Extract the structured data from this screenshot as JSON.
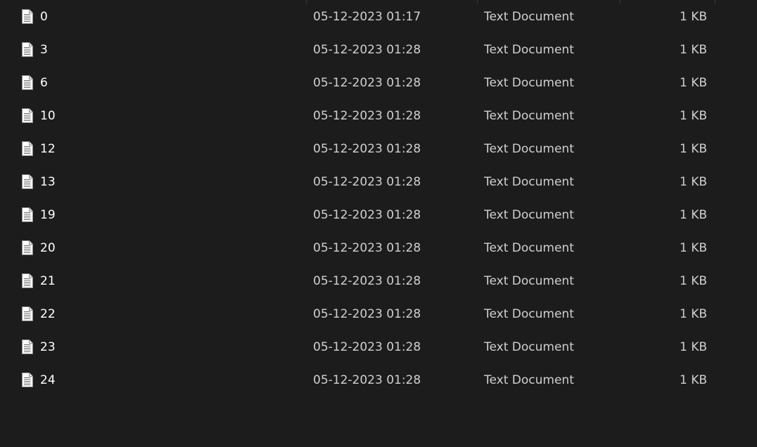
{
  "file_icon": "text-document-icon",
  "colors": {
    "background": "#1c1c1c",
    "name_text": "#ffffff",
    "detail_text": "#d0d0d0",
    "divider": "#3a3a3a"
  },
  "files": [
    {
      "name": "0",
      "date_modified": "05-12-2023 01:17",
      "type": "Text Document",
      "size": "1 KB"
    },
    {
      "name": "3",
      "date_modified": "05-12-2023 01:28",
      "type": "Text Document",
      "size": "1 KB"
    },
    {
      "name": "6",
      "date_modified": "05-12-2023 01:28",
      "type": "Text Document",
      "size": "1 KB"
    },
    {
      "name": "10",
      "date_modified": "05-12-2023 01:28",
      "type": "Text Document",
      "size": "1 KB"
    },
    {
      "name": "12",
      "date_modified": "05-12-2023 01:28",
      "type": "Text Document",
      "size": "1 KB"
    },
    {
      "name": "13",
      "date_modified": "05-12-2023 01:28",
      "type": "Text Document",
      "size": "1 KB"
    },
    {
      "name": "19",
      "date_modified": "05-12-2023 01:28",
      "type": "Text Document",
      "size": "1 KB"
    },
    {
      "name": "20",
      "date_modified": "05-12-2023 01:28",
      "type": "Text Document",
      "size": "1 KB"
    },
    {
      "name": "21",
      "date_modified": "05-12-2023 01:28",
      "type": "Text Document",
      "size": "1 KB"
    },
    {
      "name": "22",
      "date_modified": "05-12-2023 01:28",
      "type": "Text Document",
      "size": "1 KB"
    },
    {
      "name": "23",
      "date_modified": "05-12-2023 01:28",
      "type": "Text Document",
      "size": "1 KB"
    },
    {
      "name": "24",
      "date_modified": "05-12-2023 01:28",
      "type": "Text Document",
      "size": "1 KB"
    }
  ]
}
